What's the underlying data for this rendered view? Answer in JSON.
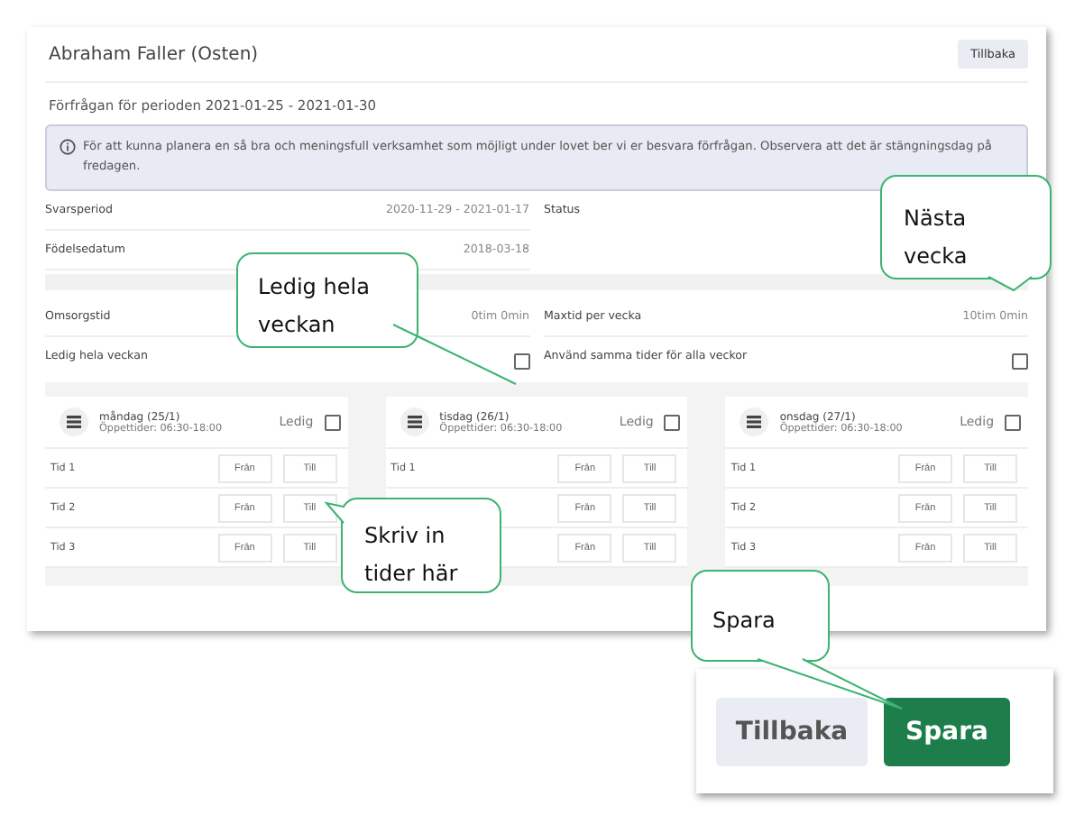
{
  "header": {
    "title": "Abraham Faller (Osten)",
    "back_button": "Tillbaka"
  },
  "period": "Förfrågan för perioden 2021-01-25 - 2021-01-30",
  "info": "För att kunna planera en så bra och meningsfull verksamhet som möjligt under lovet ber vi er besvara förfrågan. Observera att det är stängningsdag på fredagen.",
  "details_left": [
    {
      "label": "Svarsperiod",
      "value": "2020-11-29 - 2021-01-17"
    },
    {
      "label": "Födelsedatum",
      "value": "2018-03-18"
    }
  ],
  "details_right": [
    {
      "label": "Status"
    }
  ],
  "settings_left": [
    {
      "kind": "text",
      "label": "Omsorgstid",
      "value": "0tim 0min"
    },
    {
      "kind": "checkbox",
      "label": "Ledig hela veckan",
      "checked": false
    }
  ],
  "settings_right": [
    {
      "kind": "text",
      "label": "Maxtid per vecka",
      "value": "10tim 0min"
    },
    {
      "kind": "checkbox",
      "label": "Använd samma tider för alla veckor",
      "checked": false
    }
  ],
  "days": [
    {
      "day": "måndag (25/1)",
      "hours": "Öppettider: 06:30-18:00",
      "free_label": "Ledig",
      "free": false,
      "slots": [
        {
          "label": "Tid 1",
          "from": {
            "placeholder": "Från"
          },
          "to": {
            "placeholder": "Till"
          }
        },
        {
          "label": "Tid 2",
          "from": {
            "placeholder": "Från"
          },
          "to": {
            "placeholder": "Till"
          }
        },
        {
          "label": "Tid 3",
          "from": {
            "placeholder": "Från"
          },
          "to": {
            "placeholder": "Till"
          }
        }
      ]
    },
    {
      "day": "tisdag (26/1)",
      "hours": "Öppettider: 06:30-18:00",
      "free_label": "Ledig",
      "free": false,
      "slots": [
        {
          "label": "Tid 1",
          "from": {
            "placeholder": "Från"
          },
          "to": {
            "placeholder": "Till"
          }
        },
        {
          "from": {
            "placeholder": "Från"
          },
          "to": {
            "placeholder": "Till"
          }
        },
        {
          "from": {
            "placeholder": "Från"
          },
          "to": {
            "placeholder": "Till"
          }
        }
      ]
    },
    {
      "day": "onsdag (27/1)",
      "hours": "Öppettider: 06:30-18:00",
      "free_label": "Ledig",
      "free": false,
      "slots": [
        {
          "label": "Tid 1",
          "from": {
            "placeholder": "Från"
          },
          "to": {
            "placeholder": "Till"
          }
        },
        {
          "label": "Tid 2",
          "from": {
            "placeholder": "Från"
          },
          "to": {
            "placeholder": "Till"
          }
        },
        {
          "label": "Tid 3",
          "from": {
            "placeholder": "Från"
          },
          "to": {
            "placeholder": "Till"
          }
        }
      ]
    }
  ],
  "actions": {
    "back": "Tillbaka",
    "save": "Spara"
  },
  "callouts": [
    {
      "text": "Nästa vecka"
    },
    {
      "text": "Ledig hela veckan"
    },
    {
      "text": "Skriv in tider här"
    },
    {
      "text": "Spara"
    }
  ]
}
